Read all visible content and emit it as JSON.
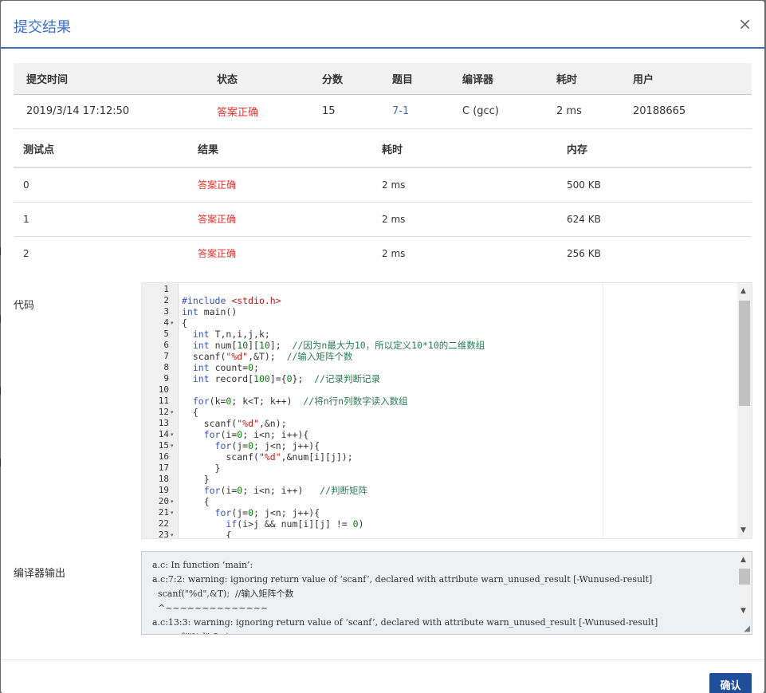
{
  "modal": {
    "title": "提交结果",
    "close_symbol": "×",
    "confirm_label": "确认"
  },
  "summary": {
    "headers": [
      "提交时间",
      "状态",
      "分数",
      "题目",
      "编译器",
      "耗时",
      "用户"
    ],
    "row": [
      "2019/3/14 17:12:50",
      "答案正确",
      "15",
      "7-1",
      "C (gcc)",
      "2 ms",
      "20188665"
    ]
  },
  "tests": {
    "headers": [
      "测试点",
      "结果",
      "耗时",
      "内存"
    ],
    "rows": [
      [
        "0",
        "答案正确",
        "2 ms",
        "500 KB"
      ],
      [
        "1",
        "答案正确",
        "2 ms",
        "624 KB"
      ],
      [
        "2",
        "答案正确",
        "2 ms",
        "256 KB"
      ]
    ]
  },
  "code_section": {
    "label": "代码",
    "line_numbers": [
      "1",
      "2",
      "3",
      "4",
      "5",
      "6",
      "7",
      "8",
      "9",
      "10",
      "11",
      "12",
      "13",
      "14",
      "15",
      "16",
      "17",
      "18",
      "19",
      "20",
      "21",
      "22",
      "23"
    ],
    "fold_marks": [
      "",
      "",
      "",
      "▾",
      "",
      "",
      "",
      "",
      "",
      "",
      "",
      "▾",
      "",
      "▾",
      "▾",
      "",
      "",
      "",
      "",
      "▾",
      "▾",
      "",
      "▾"
    ],
    "lines": [
      "",
      "#include <stdio.h>",
      "int main()",
      "{",
      "  int T,n,i,j,k;",
      "  int num[10][10];  //因为n最大为10，所以定义10*10的二维数组",
      "  scanf(\"%d\",&T);  //输入矩阵个数",
      "  int count=0;",
      "  int record[100]={0};  //记录判断记录",
      "",
      "  for(k=0; k<T; k++)  //将n行n列数字读入数组",
      "  {",
      "    scanf(\"%d\",&n);",
      "    for(i=0; i<n; i++){",
      "      for(j=0; j<n; j++){",
      "        scanf(\"%d\",&num[i][j]);",
      "      }",
      "    }",
      "    for(i=0; i<n; i++)   //判断矩阵",
      "    {",
      "      for(j=0; j<n; j++){",
      "        if(i>j && num[i][j] != 0)",
      "        {"
    ]
  },
  "compiler_section": {
    "label": "编译器输出",
    "lines": [
      "a.c: In function ‘main’:",
      "a.c:7:2: warning: ignoring return value of ‘scanf’, declared with attribute warn_unused_result [-Wunused-result]",
      "  scanf(\"%d\",&T);  //输入矩阵个数",
      "  ^~~~~~~~~~~~~~~",
      "a.c:13:3: warning: ignoring return value of ‘scanf’, declared with attribute warn_unused_result [-Wunused-result]",
      "   scanf(\"%d\",&n);"
    ]
  }
}
